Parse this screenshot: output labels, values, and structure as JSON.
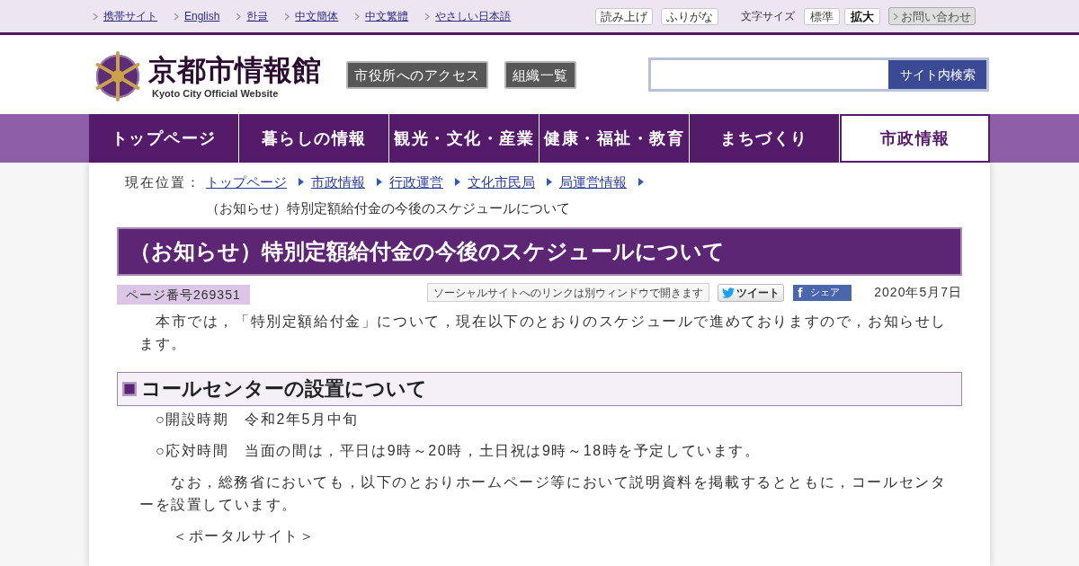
{
  "top_bar": {
    "language_links": [
      {
        "label": "携帯サイト"
      },
      {
        "label": "English"
      },
      {
        "label": "한글"
      },
      {
        "label": "中文簡体"
      },
      {
        "label": "中文繁體"
      },
      {
        "label": "やさしい日本語"
      }
    ],
    "tools": [
      "読み上げ",
      "ふりがな"
    ],
    "font_size": {
      "label": "文字サイズ",
      "options": [
        {
          "label": "標準",
          "selected": false
        },
        {
          "label": "拡大",
          "selected": true
        }
      ]
    },
    "contact": "お問い合わせ"
  },
  "header": {
    "logo": {
      "title": "京都市情報館",
      "subtitle": "Kyoto City Official Website"
    },
    "buttons": [
      "市役所へのアクセス",
      "組織一覧"
    ],
    "search": {
      "button": "サイト内検索"
    }
  },
  "nav": [
    {
      "label": "トップページ",
      "selected": false
    },
    {
      "label": "暮らしの情報",
      "selected": false
    },
    {
      "label": "観光・文化・産業",
      "selected": false
    },
    {
      "label": "健康・福祉・教育",
      "selected": false
    },
    {
      "label": "まちづくり",
      "selected": false
    },
    {
      "label": "市政情報",
      "selected": true
    }
  ],
  "breadcrumb": {
    "label": "現在位置：",
    "links": [
      "トップページ",
      "市政情報",
      "行政運営",
      "文化市民局",
      "局運営情報"
    ],
    "current": "（お知らせ）特別定額給付金の今後のスケジュールについて"
  },
  "article": {
    "title": "（お知らせ）特別定額給付金の今後のスケジュールについて",
    "page_number": "ページ番号269351",
    "social_note": "ソーシャルサイトへのリンクは別ウィンドウで開きます",
    "social_buttons": [
      {
        "kind": "twitter",
        "label": "ツイート"
      },
      {
        "kind": "facebook",
        "icon": "f",
        "label": "シェア"
      }
    ],
    "date": "2020年5月7日",
    "intro": "本市では，「特別定額給付金」について，現在以下のとおりのスケジュールで進めておりますので，お知らせします。"
  },
  "sections": [
    {
      "heading": "コールセンターの設置について",
      "blocks": [
        {
          "kind": "item",
          "text": "○開設時期　令和2年5月中旬"
        },
        {
          "kind": "item",
          "text": "○応対時間　当面の間は，平日は9時～20時，土日祝は9時～18時を予定しています。"
        },
        {
          "kind": "paragraph",
          "text": "なお，総務省においても，以下のとおりホームページ等において説明資料を掲載するとともに，コールセンターを設置しています。"
        },
        {
          "kind": "label",
          "text": "＜ポータルサイト＞"
        }
      ]
    }
  ]
}
